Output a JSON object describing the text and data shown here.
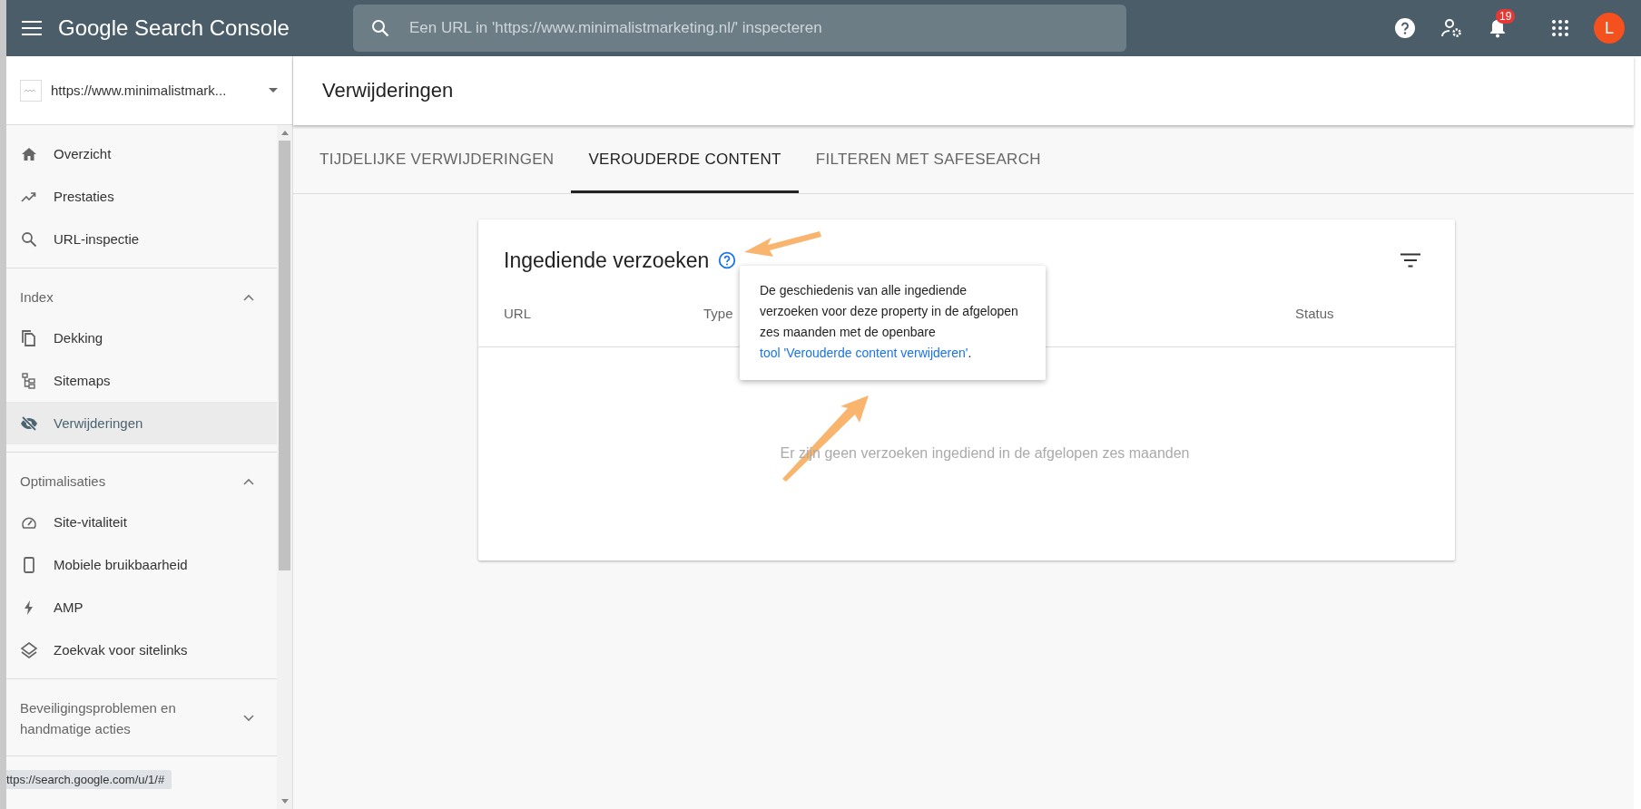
{
  "topbar": {
    "app_name": "Google Search Console",
    "search": {
      "placeholder": "Een URL in 'https://www.minimalistmarketing.nl/' inspecteren"
    },
    "notification_count": "19",
    "avatar_letter": "L"
  },
  "property": {
    "url": "https://www.minimalistmark..."
  },
  "sidebar": {
    "sections": [
      {
        "items": [
          {
            "label": "Overzicht",
            "selected": false
          },
          {
            "label": "Prestaties",
            "selected": false
          },
          {
            "label": "URL-inspectie",
            "selected": false
          }
        ]
      },
      {
        "title": "Index",
        "expanded": true,
        "items": [
          {
            "label": "Dekking",
            "selected": false
          },
          {
            "label": "Sitemaps",
            "selected": false
          },
          {
            "label": "Verwijderingen",
            "selected": true
          }
        ]
      },
      {
        "title": "Optimalisaties",
        "expanded": true,
        "items": [
          {
            "label": "Site-vitaliteit",
            "selected": false
          },
          {
            "label": "Mobiele bruikbaarheid",
            "selected": false
          },
          {
            "label": "AMP",
            "selected": false
          },
          {
            "label": "Zoekvak voor sitelinks",
            "selected": false
          }
        ]
      },
      {
        "title": "Beveiligingsproblemen en handmatige acties",
        "expanded": false
      }
    ]
  },
  "page": {
    "title": "Verwijderingen"
  },
  "tabs": [
    {
      "label": "TIJDELIJKE VERWIJDERINGEN",
      "selected": false
    },
    {
      "label": "VEROUDERDE CONTENT",
      "selected": true
    },
    {
      "label": "FILTEREN MET SAFESEARCH",
      "selected": false
    }
  ],
  "card": {
    "title": "Ingediende verzoeken",
    "columns": [
      "URL",
      "Type",
      "Status"
    ],
    "empty_message": "Er zijn geen verzoeken ingediend in de afgelopen zes maanden"
  },
  "tooltip": {
    "text": "De geschiedenis van alle ingediende verzoeken voor deze property in de afgelopen zes maanden met de openbare",
    "link": "tool 'Verouderde content verwijderen'",
    "end": "."
  },
  "status_url": "ttps://search.google.com/u/1/#"
}
